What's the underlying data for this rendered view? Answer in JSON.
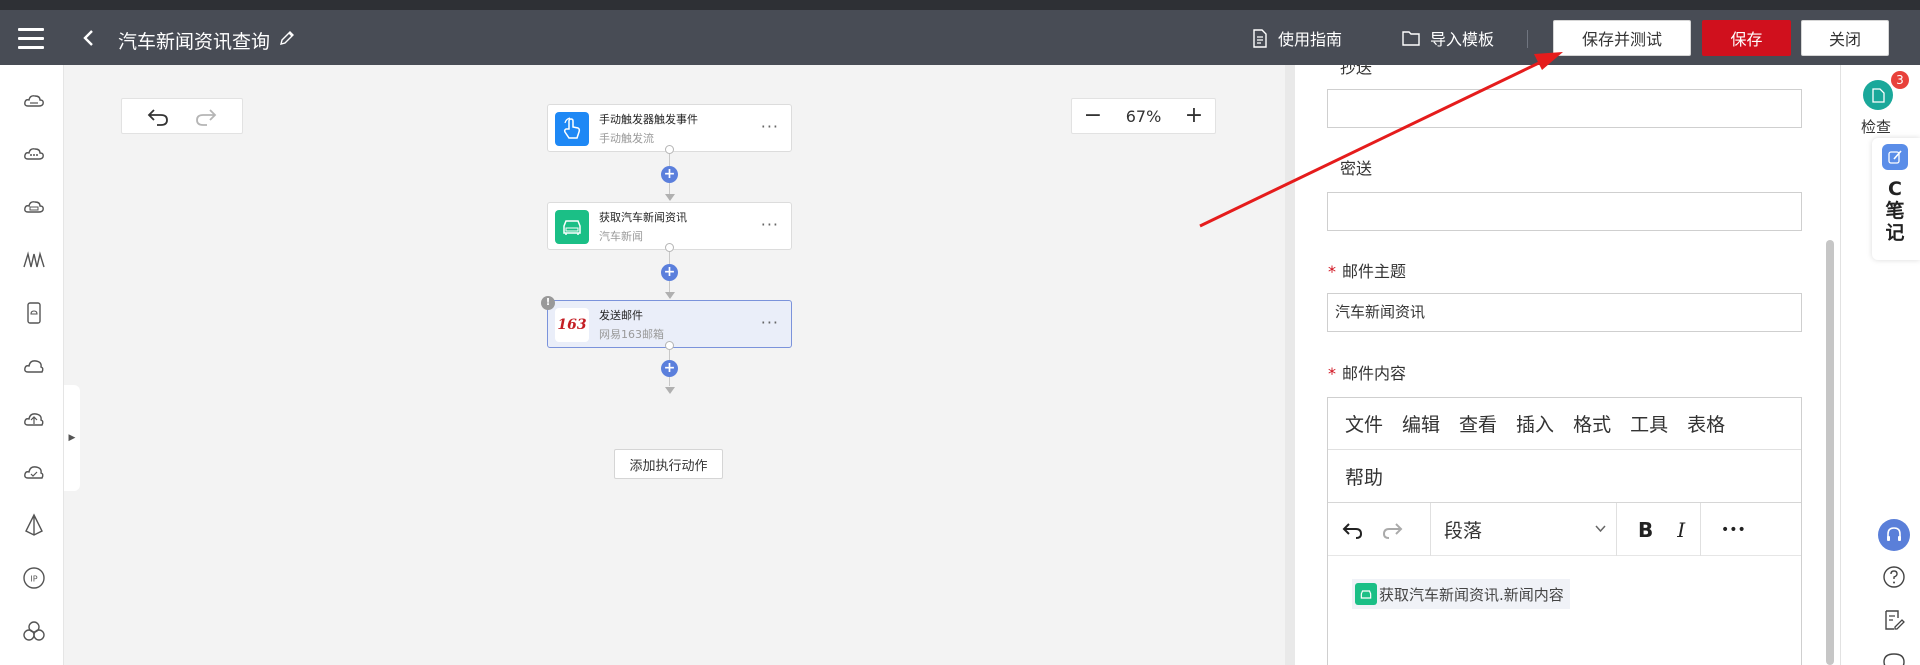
{
  "header": {
    "title": "汽车新闻资讯查询",
    "guide_label": "使用指南",
    "import_label": "导入模板",
    "save_test_label": "保存并测试",
    "save_label": "保存",
    "close_label": "关闭"
  },
  "canvas": {
    "zoom": "67%",
    "nodes": [
      {
        "title": "手动触发器触发事件",
        "subtitle": "手动触发流",
        "icon": "hand-pointer-icon",
        "color": "#1e88f5"
      },
      {
        "title": "获取汽车新闻资讯",
        "subtitle": "汽车新闻",
        "icon": "news-car-icon",
        "color": "#1bbf86"
      },
      {
        "title": "发送邮件",
        "subtitle": "网易163邮箱",
        "icon": "163-mail-logo",
        "logo_text": "163",
        "color": "#c41e24"
      }
    ],
    "add_action_label": "添加执行动作"
  },
  "panel": {
    "cc_label": "抄送",
    "bcc_label": "密送",
    "subject_label": "邮件主题",
    "subject_value": "汽车新闻资讯",
    "content_label": "邮件内容",
    "required_mark": "*",
    "editor": {
      "menu": [
        "文件",
        "编辑",
        "查看",
        "插入",
        "格式",
        "工具",
        "表格",
        "帮助"
      ],
      "block_format": "段落",
      "bold": "B",
      "italic": "I",
      "more": "•••",
      "variable_chip": "获取汽车新闻资讯.新闻内容"
    }
  },
  "right_strip": {
    "check_label": "检查",
    "badge_count": "3",
    "note_letter": "C",
    "note_text": [
      "笔",
      "记"
    ]
  },
  "colors": {
    "header_bg": "#484c55",
    "save_red": "#d0101d",
    "plus_blue": "#5b7fdc",
    "selected_node_bg": "#eaeef9",
    "annotation_red": "#e51c1c"
  }
}
